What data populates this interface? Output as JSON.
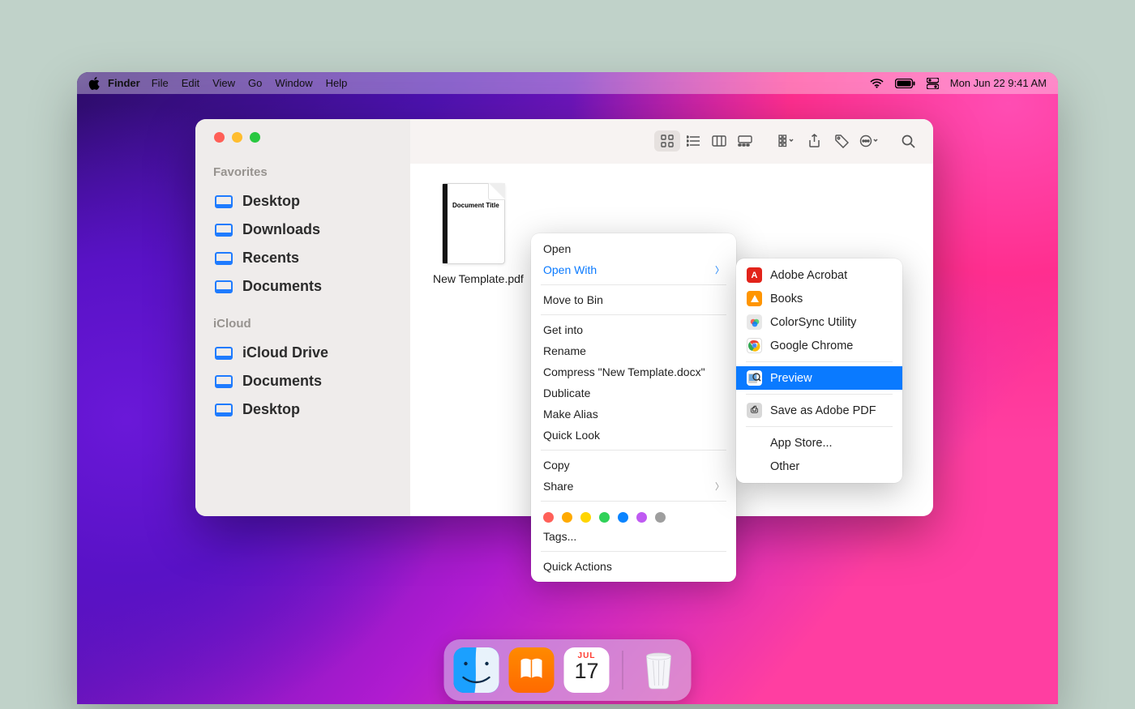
{
  "menubar": {
    "app_name": "Finder",
    "items": [
      "File",
      "Edit",
      "View",
      "Go",
      "Window",
      "Help"
    ],
    "clock": "Mon Jun 22  9:41 AM"
  },
  "sidebar": {
    "sections": [
      {
        "title": "Favorites",
        "items": [
          "Desktop",
          "Downloads",
          "Recents",
          "Documents"
        ]
      },
      {
        "title": "iCloud",
        "items": [
          "iCloud Drive",
          "Documents",
          "Desktop"
        ]
      }
    ]
  },
  "file": {
    "thumb_title": "Document Title",
    "label": "New Template.pdf"
  },
  "context_menu": {
    "open": "Open",
    "open_with": "Open With",
    "move_to_bin": "Move to Bin",
    "get_into": "Get into",
    "rename": "Rename",
    "compress": "Compress \"New Template.docx\"",
    "dublicate": "Dublicate",
    "make_alias": "Make Alias",
    "quick_look": "Quick Look",
    "copy": "Copy",
    "share": "Share",
    "tags": "Tags...",
    "quick_actions": "Quick Actions",
    "tag_colors": [
      "#ff6059",
      "#ffaa00",
      "#ffd500",
      "#30d158",
      "#0a84ff",
      "#bf5af2",
      "#9e9e9e"
    ]
  },
  "open_with": {
    "apps": [
      {
        "name": "Adobe Acrobat",
        "color": "#e2231a",
        "txt": "A"
      },
      {
        "name": "Books",
        "color": "#ff9500",
        "txt": "▲"
      },
      {
        "name": "ColorSync Utility",
        "color": "",
        "txt": ""
      },
      {
        "name": "Google Chrome",
        "color": "",
        "txt": ""
      },
      {
        "name": "Preview",
        "color": "",
        "txt": ""
      },
      {
        "name": "Save as Adobe PDF",
        "color": "#bfbfbf",
        "txt": "⎙"
      }
    ],
    "app_store": "App Store...",
    "other": "Other",
    "selected_index": 4
  },
  "dock": {
    "calendar_month": "JUL",
    "calendar_day": "17"
  }
}
